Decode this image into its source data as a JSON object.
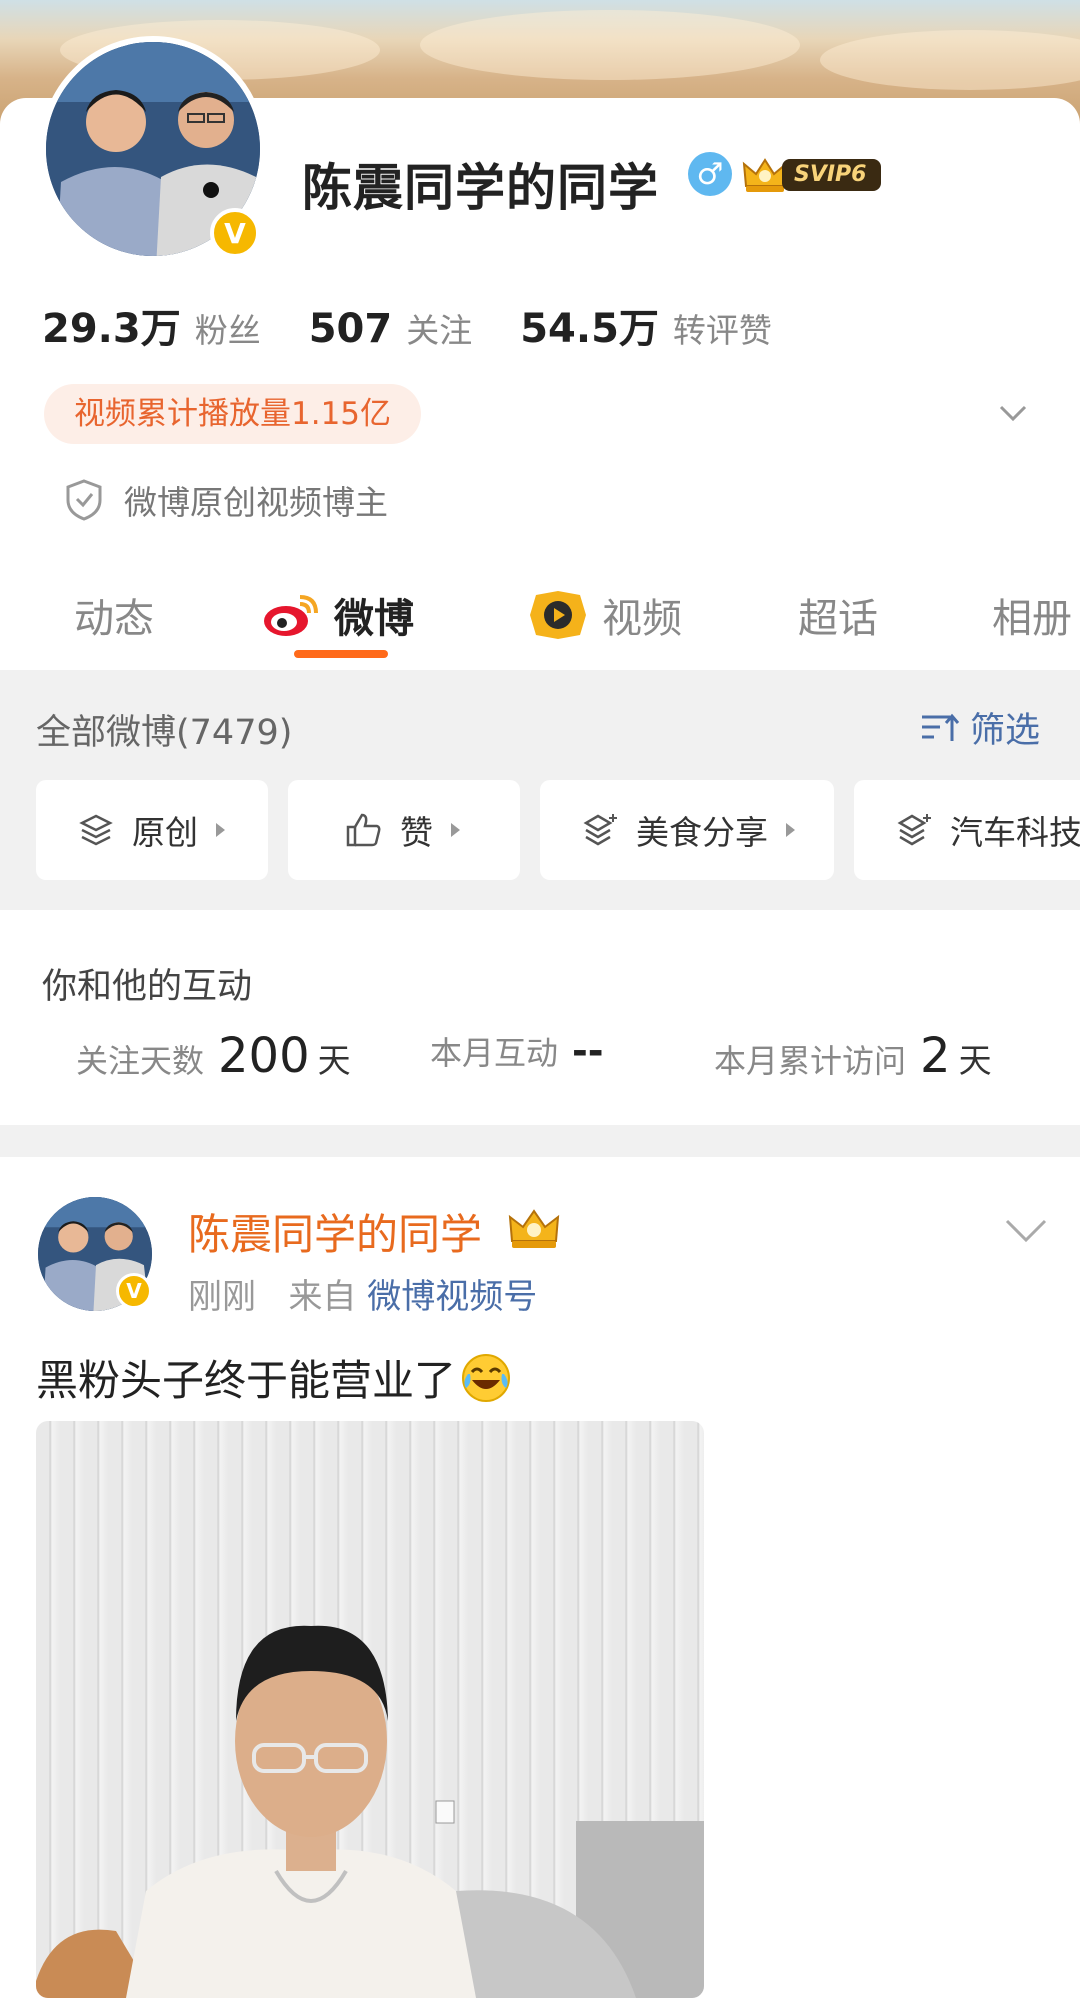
{
  "profile": {
    "name": "陈震同学的同学",
    "gender_icon": "male-icon",
    "vip_badge": "SVIP6",
    "verified_badge": "V"
  },
  "stats": [
    {
      "value": "29.3万",
      "label": "粉丝"
    },
    {
      "value": "507",
      "label": "关注"
    },
    {
      "value": "54.5万",
      "label": "转评赞"
    }
  ],
  "video_pill": "视频累计播放量1.15亿",
  "origin_label": "微博原创视频博主",
  "tabs": [
    {
      "label": "动态"
    },
    {
      "label": "微博",
      "icon": "weibo-icon",
      "active": true
    },
    {
      "label": "视频",
      "icon": "video-icon"
    },
    {
      "label": "超话"
    },
    {
      "label": "相册"
    }
  ],
  "filter": {
    "all_label": "全部微博(7479)",
    "filter_label": "筛选",
    "chips": [
      {
        "label": "原创",
        "icon": "layers-icon"
      },
      {
        "label": "赞",
        "icon": "thumbs-up-icon"
      },
      {
        "label": "美食分享",
        "icon": "layers-sparkle-icon"
      },
      {
        "label": "汽车科技",
        "icon": "layers-sparkle-icon"
      }
    ]
  },
  "interaction": {
    "title": "你和他的互动",
    "items": [
      {
        "label": "关注天数",
        "value": "200",
        "unit": "天"
      },
      {
        "label": "本月互动",
        "value": "--",
        "unit": ""
      },
      {
        "label": "本月累计访问",
        "value": "2",
        "unit": "天"
      }
    ]
  },
  "post": {
    "author": "陈震同学的同学",
    "time": "刚刚",
    "from_label": "来自",
    "source": "微博视频号",
    "text": "黑粉头子终于能营业了",
    "emoji": "laughing-tears-emoji"
  },
  "colors": {
    "accent_orange": "#ff6a1a",
    "link_blue": "#4a6ea8",
    "name_orange": "#e86a1e",
    "pill_bg": "#fdeee7"
  }
}
